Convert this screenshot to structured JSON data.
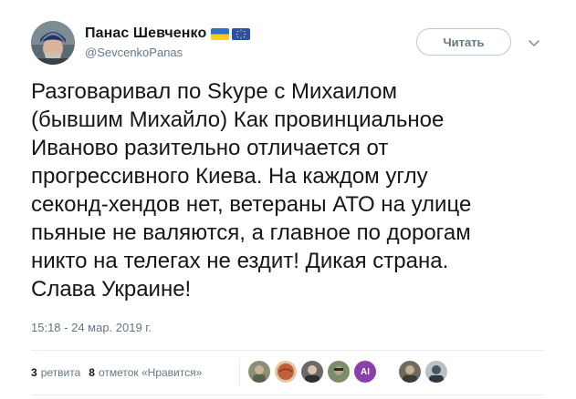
{
  "author": {
    "display_name": "Панас Шевченко",
    "handle": "@SevcenkoPanas",
    "flags": [
      "ukraine-flag-icon",
      "eu-flag-icon"
    ]
  },
  "follow_button": {
    "label": "Читать"
  },
  "tweet": {
    "text": "Разговаривал по Skype с Михаилом\n(бывшим Михайло) Как провинциальное\nИваново разительно отличается от\nпрогрессивного Киева. На каждом углу\nсеконд-хендов нет, ветераны АТО на улице\nпьяные не валяются, а главное по дорогам\nникто на телегах не ездит! Дикая страна.\nСлава Украине!",
    "timestamp": "15:18 - 24 мар. 2019 г."
  },
  "stats": {
    "retweets_count": "3",
    "retweets_label": "ретвита",
    "likes_count": "8",
    "likes_label": "отметок «Нравится»"
  },
  "likers": [
    {
      "icon": "liker-avatar-icon",
      "color": "#8a8f74"
    },
    {
      "icon": "liker-avatar-icon",
      "color": "#c0603a"
    },
    {
      "icon": "liker-avatar-icon",
      "color": "#6a6a6a"
    },
    {
      "icon": "liker-avatar-icon",
      "color": "#7d8d6a"
    },
    {
      "icon": "liker-avatar-icon",
      "color": "#8b3fa8",
      "text": "AI"
    },
    {
      "icon": "liker-avatar-icon",
      "color": "#6e6b5e"
    },
    {
      "icon": "liker-avatar-icon",
      "color": "#4a5563"
    }
  ],
  "colors": {
    "text_primary": "#14171a",
    "text_secondary": "#657786",
    "divider": "#e6ecf0"
  }
}
